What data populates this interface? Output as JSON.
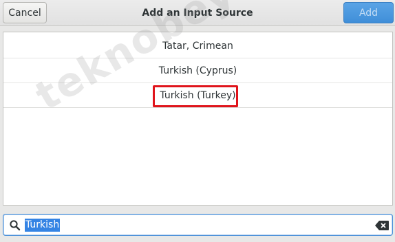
{
  "dialog": {
    "title": "Add an Input Source",
    "cancel_label": "Cancel",
    "add_label": "Add"
  },
  "list": {
    "items": [
      "Tatar, Crimean",
      "Turkish (Cyprus)",
      "Turkish (Turkey)"
    ]
  },
  "search": {
    "value": "Turkish"
  },
  "watermark": "teknobeyin.com",
  "colors": {
    "accent": "#3584e4",
    "highlight_box": "#e0141b",
    "add_button": "#4a97df"
  },
  "icons": [
    "search-icon",
    "clear-icon"
  ]
}
